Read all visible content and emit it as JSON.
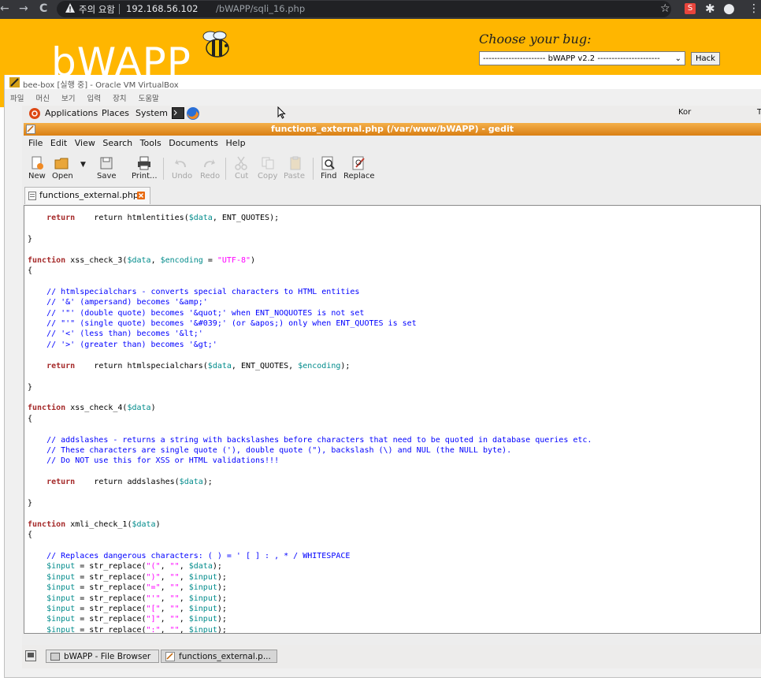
{
  "browser": {
    "nav_back": "←",
    "nav_forward": "→",
    "nav_reload": "C",
    "warning_text": "주의 요함",
    "url_host": "192.168.56.102",
    "url_path": "/bWAPP/sqli_16.php",
    "ext_icons": [
      "☆",
      "S",
      "✱",
      "●",
      "⋮"
    ]
  },
  "bwapp": {
    "logo": "bWAPP",
    "choose_label": "Choose your bug:",
    "selected_bug": "---------------------- bWAPP v2.2 ----------------------",
    "hack_label": "Hack"
  },
  "vbox": {
    "title": "bee-box [실행 중] - Oracle VM VirtualBox",
    "menu": [
      "파일",
      "머신",
      "보기",
      "입력",
      "장치",
      "도움말"
    ]
  },
  "gnome_panel": {
    "applications": "Applications",
    "places": "Places",
    "system": "System",
    "keyboard": "Kor",
    "edge": "T"
  },
  "gedit": {
    "title": "functions_external.php (/var/www/bWAPP) - gedit",
    "menu": [
      "File",
      "Edit",
      "View",
      "Search",
      "Tools",
      "Documents",
      "Help"
    ],
    "toolbar": {
      "new": "New",
      "open": "Open",
      "save": "Save",
      "print": "Print...",
      "undo": "Undo",
      "redo": "Redo",
      "cut": "Cut",
      "copy": "Copy",
      "paste": "Paste",
      "find": "Find",
      "replace": "Replace"
    },
    "tab_label": "functions_external.php"
  },
  "code": {
    "l01": "    return htmlentities(",
    "l01v": "$data",
    "l01e": ", ENT_QUOTES);",
    "l02": "}",
    "l03k": "function",
    "l03": " xss_check_3(",
    "l03v1": "$data",
    "l03m": ", ",
    "l03v2": "$encoding",
    "l03e1": " = ",
    "l03s": "\"UTF-8\"",
    "l03e2": ")",
    "l04": "{",
    "l05": "    // htmlspecialchars - converts special characters to HTML entities",
    "l06": "    // '&' (ampersand) becomes '&amp;'",
    "l07": "    // '\"' (double quote) becomes '&quot;' when ENT_NOQUOTES is not set",
    "l08": "    // \"'\" (single quote) becomes '&#039;' (or &apos;) only when ENT_QUOTES is set",
    "l09": "    // '<' (less than) becomes '&lt;'",
    "l10": "    // '>' (greater than) becomes '&gt;'",
    "l11": "    return htmlspecialchars(",
    "l11v1": "$data",
    "l11m": ", ENT_QUOTES, ",
    "l11v2": "$encoding",
    "l11e": ");",
    "l12": "}",
    "l13k": "function",
    "l13": " xss_check_4(",
    "l13v": "$data",
    "l13e": ")",
    "l14": "{",
    "l15": "    // addslashes - returns a string with backslashes before characters that need to be quoted in database queries etc.",
    "l16": "    // These characters are single quote ('), double quote (\"), backslash (\\) and NUL (the NULL byte).",
    "l17": "    // Do NOT use this for XSS or HTML validations!!!",
    "l18": "    return addslashes(",
    "l18v": "$data",
    "l18e": ");",
    "l19": "}",
    "l20k": "function",
    "l20": " xmli_check_1(",
    "l20v": "$data",
    "l20e": ")",
    "l21": "{",
    "l22": "    // Replaces dangerous characters: ( ) = ' [ ] : , * / WHITESPACE",
    "r1s": "\"(\"",
    "r2s": "\")\"",
    "r3s": "\"=\"",
    "r4s": "\"'\"",
    "r5s": "\"[\"",
    "r6s": "\"]\"",
    "r7s": "\":\"",
    "rq": "\"\"",
    "rin": "$input",
    "rdat": "$data",
    "rfn": " = str_replace(",
    "rc": ", ",
    "re": ");"
  },
  "taskbar": {
    "item1": "bWAPP - File Browser",
    "item2": "functions_external.p..."
  }
}
